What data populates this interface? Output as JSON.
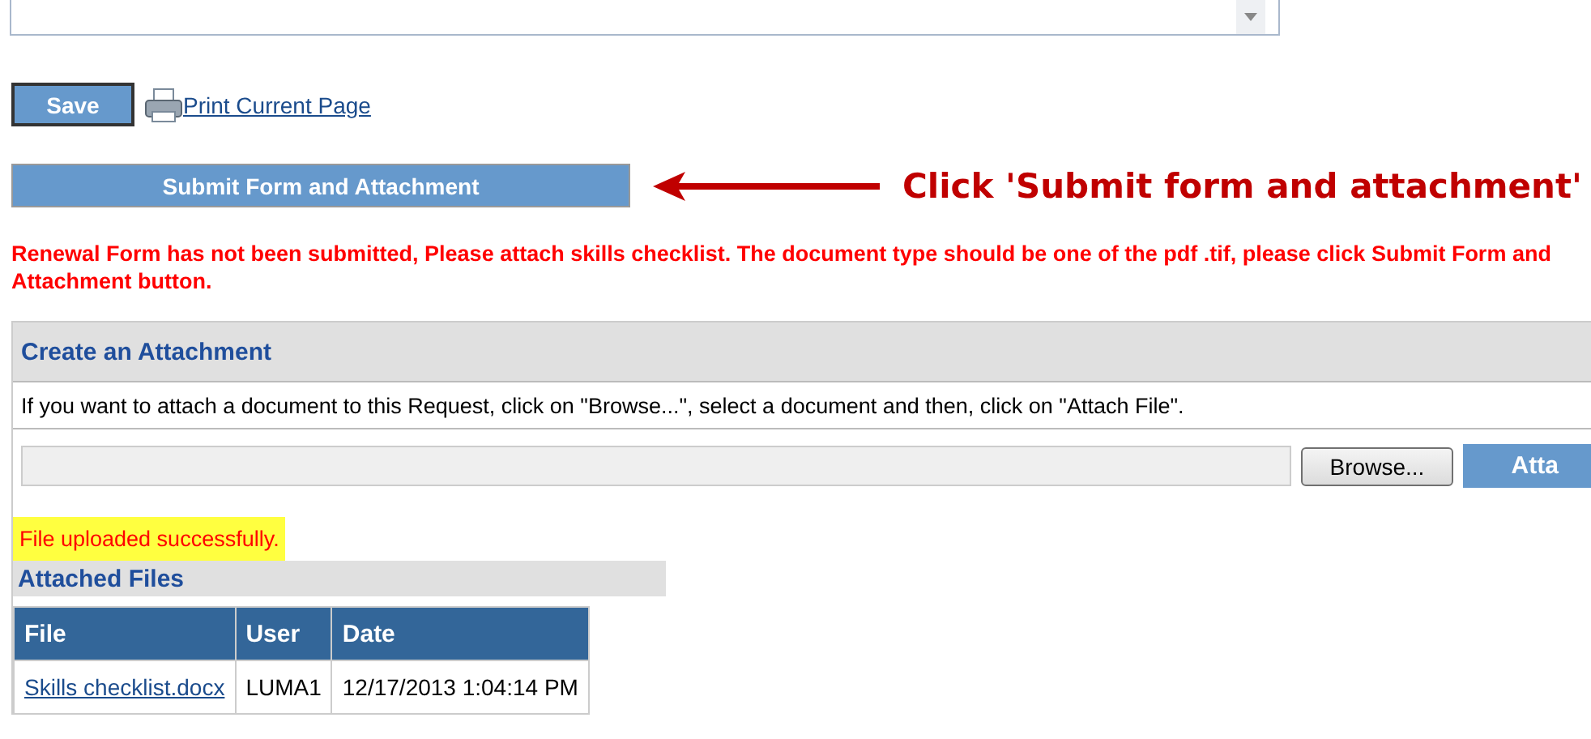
{
  "save_button": "Save",
  "print_link": "Print Current Page",
  "submit_button": "Submit Form and Attachment",
  "annotation": "Click 'Submit form and attachment'",
  "error_message": "Renewal Form has not been submitted, Please attach skills checklist. The document type should be one of the pdf .tif, please click Submit Form and Attachment button.",
  "attachment_panel": {
    "title": "Create an Attachment",
    "instructions": "If you want to attach a document to this Request, click on \"Browse...\", select a document and then, click on \"Attach File\".",
    "browse_button": "Browse...",
    "attach_button": "Atta"
  },
  "success_message": "File uploaded successfully.",
  "attached_files": {
    "title": "Attached Files",
    "columns": [
      "File",
      "User",
      "Date"
    ],
    "rows": [
      {
        "file": "Skills checklist.docx",
        "user": "LUMA1",
        "date": "12/17/2013 1:04:14 PM"
      }
    ]
  }
}
